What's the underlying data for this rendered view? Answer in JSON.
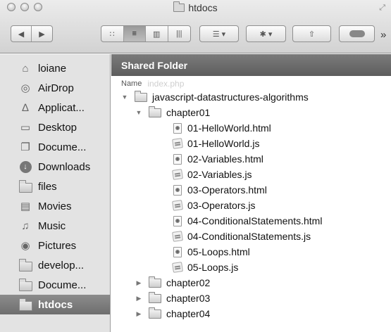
{
  "window": {
    "title": "htdocs"
  },
  "toolbar": {
    "back_icon": "◀",
    "forward_icon": "▶",
    "view_icons": [
      "∷",
      "≡",
      "▥",
      "|||"
    ],
    "arrange_icon": "☰ ▾",
    "action_icon": "✱ ▾",
    "share_icon": "⇧",
    "overflow": "»"
  },
  "sidebar": {
    "items": [
      {
        "label": "loiane",
        "icon": "home-icon",
        "glyph": "⌂"
      },
      {
        "label": "AirDrop",
        "icon": "airdrop-icon",
        "glyph": "◎"
      },
      {
        "label": "Applicat...",
        "icon": "applications-icon",
        "glyph": "∆"
      },
      {
        "label": "Desktop",
        "icon": "desktop-icon",
        "glyph": "▭"
      },
      {
        "label": "Docume...",
        "icon": "documents-icon",
        "glyph": "❐"
      },
      {
        "label": "Downloads",
        "icon": "downloads-icon",
        "glyph": "↓"
      },
      {
        "label": "files",
        "icon": "folder-icon",
        "glyph": ""
      },
      {
        "label": "Movies",
        "icon": "movies-icon",
        "glyph": "▤"
      },
      {
        "label": "Music",
        "icon": "music-icon",
        "glyph": "♫"
      },
      {
        "label": "Pictures",
        "icon": "pictures-icon",
        "glyph": "◉"
      },
      {
        "label": "develop...",
        "icon": "folder-icon",
        "glyph": ""
      },
      {
        "label": "Docume...",
        "icon": "folder-icon",
        "glyph": ""
      },
      {
        "label": "htdocs",
        "icon": "folder-icon",
        "glyph": "",
        "selected": true
      }
    ]
  },
  "main": {
    "header": "Shared Folder",
    "column_name": "Name",
    "column_ghost": "index.php",
    "rows": [
      {
        "label": "javascript-datastructures-algorithms",
        "type": "folder",
        "expanded": true,
        "depth": 0
      },
      {
        "label": "chapter01",
        "type": "folder",
        "expanded": true,
        "depth": 1
      },
      {
        "label": "01-HelloWorld.html",
        "type": "html",
        "depth": 2
      },
      {
        "label": "01-HelloWorld.js",
        "type": "js",
        "depth": 2
      },
      {
        "label": "02-Variables.html",
        "type": "html",
        "depth": 2
      },
      {
        "label": "02-Variables.js",
        "type": "js",
        "depth": 2
      },
      {
        "label": "03-Operators.html",
        "type": "html",
        "depth": 2
      },
      {
        "label": "03-Operators.js",
        "type": "js",
        "depth": 2
      },
      {
        "label": "04-ConditionalStatements.html",
        "type": "html",
        "depth": 2
      },
      {
        "label": "04-ConditionalStatements.js",
        "type": "js",
        "depth": 2
      },
      {
        "label": "05-Loops.html",
        "type": "html",
        "depth": 2
      },
      {
        "label": "05-Loops.js",
        "type": "js",
        "depth": 2
      },
      {
        "label": "chapter02",
        "type": "folder",
        "expanded": false,
        "depth": 1
      },
      {
        "label": "chapter03",
        "type": "folder",
        "expanded": false,
        "depth": 1
      },
      {
        "label": "chapter04",
        "type": "folder",
        "expanded": false,
        "depth": 1
      }
    ]
  }
}
